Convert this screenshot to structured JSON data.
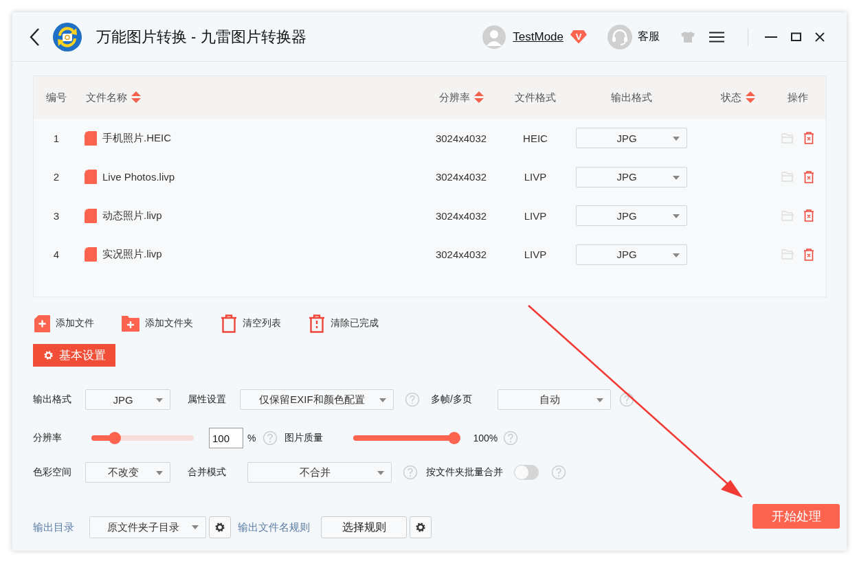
{
  "window": {
    "title": "万能图片转换 - 九雷图片转换器"
  },
  "header": {
    "user": "TestMode",
    "user_badge": "V",
    "support": "客服"
  },
  "table": {
    "columns": [
      {
        "label": "编号",
        "sortable": false
      },
      {
        "label": "文件名称",
        "sortable": true
      },
      {
        "label": "分辨率",
        "sortable": true
      },
      {
        "label": "文件格式",
        "sortable": false
      },
      {
        "label": "输出格式",
        "sortable": false
      },
      {
        "label": "状态",
        "sortable": true
      },
      {
        "label": "操作",
        "sortable": false
      }
    ],
    "rows": [
      {
        "index": "1",
        "name": "手机照片.HEIC",
        "resolution": "3024x4032",
        "format": "HEIC",
        "output": "JPG"
      },
      {
        "index": "2",
        "name": "Live Photos.livp",
        "resolution": "3024x4032",
        "format": "LIVP",
        "output": "JPG"
      },
      {
        "index": "3",
        "name": "动态照片.livp",
        "resolution": "3024x4032",
        "format": "LIVP",
        "output": "JPG"
      },
      {
        "index": "4",
        "name": "实况照片.livp",
        "resolution": "3024x4032",
        "format": "LIVP",
        "output": "JPG"
      }
    ]
  },
  "toolbar": [
    {
      "label": "添加文件",
      "kind": "add-file"
    },
    {
      "label": "添加文件夹",
      "kind": "add-folder"
    },
    {
      "label": "清空列表",
      "kind": "clear"
    },
    {
      "label": "清除已完成",
      "kind": "clear-done"
    }
  ],
  "settings_tab": "基本设置",
  "settings": {
    "output_format": {
      "label": "输出格式",
      "value": "JPG"
    },
    "attributes": {
      "label": "属性设置",
      "value": "仅保留EXIF和颜色配置"
    },
    "multi_frame": {
      "label": "多帧/多页",
      "value": "自动"
    },
    "resolution": {
      "label": "分辨率",
      "level": 0.23,
      "value": "100",
      "unit": "%"
    },
    "quality": {
      "label": "图片质量",
      "level": 1,
      "reading": "100%"
    },
    "color_space": {
      "label": "色彩空间",
      "value": "不改变"
    },
    "merge_mode": {
      "label": "合并模式",
      "value": "不合并"
    },
    "batch_merge": {
      "label": "按文件夹批量合并",
      "on": false
    }
  },
  "footer": {
    "output_dir_label": "输出目录",
    "output_dir": "原文件夹子目录",
    "name_rule_label": "输出文件名规则",
    "name_rule_button": "选择规则",
    "start_button": "开始处理"
  }
}
